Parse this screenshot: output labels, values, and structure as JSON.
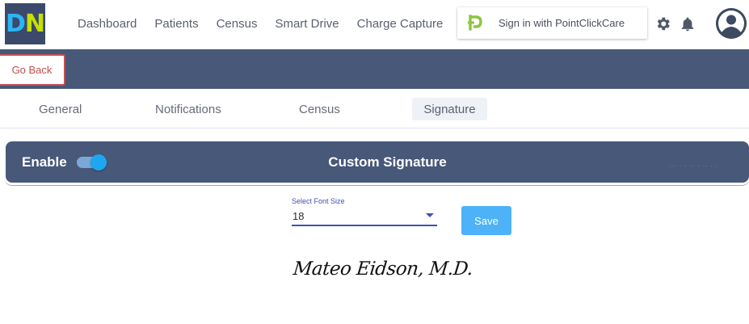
{
  "app": {
    "logo_letters": [
      "D",
      "N"
    ],
    "colors": {
      "logo_bg": "#3b4a6b",
      "logo_d": "#29b6f6",
      "logo_n": "#c6e000",
      "header_blue": "#475879",
      "accent": "#4db2f8",
      "select_blue": "#3f51b5"
    }
  },
  "nav": {
    "items": [
      "Dashboard",
      "Patients",
      "Census",
      "Smart Drive",
      "Charge Capture"
    ]
  },
  "pcc": {
    "label": "Sign in with PointClickCare",
    "icon": "pointclickcare-icon"
  },
  "header_icons": [
    "gear-icon",
    "bell-icon",
    "avatar"
  ],
  "subheader": {
    "go_back_label": "Go Back"
  },
  "settings": {
    "tabs": [
      {
        "label": "General",
        "active": false
      },
      {
        "label": "Notifications",
        "active": false
      },
      {
        "label": "Census",
        "active": false
      },
      {
        "label": "Signature",
        "active": true
      }
    ]
  },
  "signature_card": {
    "enable_label": "Enable",
    "enabled": true,
    "title": "Custom Signature"
  },
  "font_size": {
    "label": "Select Font Size",
    "value": "18"
  },
  "save_label": "Save",
  "signature_text": "Mateo Eidson, M.D."
}
